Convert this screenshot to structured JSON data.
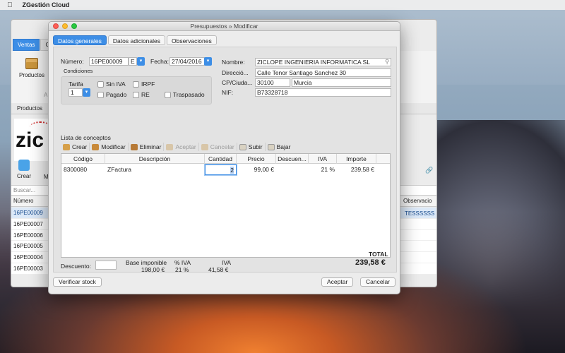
{
  "menubar": {
    "app_name": "ZGestión Cloud"
  },
  "bg_window": {
    "tabs": [
      "Ventas",
      "C"
    ],
    "ribbon_button": "Productos",
    "ribbon_group_letter": "A",
    "subtab": "Productos",
    "logo_text": "zic",
    "crear_label": "Crear",
    "m_label": "M",
    "search_placeholder": "Buscar...",
    "list_header": "Número",
    "obs_header": "Observacio",
    "obs_value": "TESSSSSS",
    "rows": [
      "16PE00009",
      "16PE00007",
      "16PE00006",
      "16PE00005",
      "16PE00004",
      "16PE00003"
    ]
  },
  "dialog": {
    "title": "Presupuestos » Modificar",
    "tabs": [
      "Datos generales",
      "Datos adicionales",
      "Observaciones"
    ],
    "numero_label": "Número:",
    "numero_value": "16PE00009",
    "serie_value": "E",
    "fecha_label": "Fecha:",
    "fecha_value": "27/04/2016",
    "condiciones_label": "Condiciones",
    "tarifa_label": "Tarifa",
    "tarifa_value": "1",
    "checks": [
      "Sin IVA",
      "IRPF",
      "Pagado",
      "RE",
      "Traspasado"
    ],
    "nombre_label": "Nombre:",
    "nombre_value": "ZICLOPE INGENIERIA INFORMATICA SL",
    "direccion_label": "Direcció...",
    "direccion_value": "Calle Tenor Santiago Sanchez 30",
    "cp_label": "CP/Ciuda...",
    "cp_value": "30100",
    "ciudad_value": "Murcia",
    "nif_label": "NIF:",
    "nif_value": "B73328718",
    "lista_label": "Lista de conceptos",
    "toolbar": [
      "Crear",
      "Modificar",
      "Eliminar",
      "Aceptar",
      "Cancelar",
      "Subir",
      "Bajar"
    ],
    "columns": [
      "Código",
      "Descripción",
      "Cantidad",
      "Precio",
      "Descuen...",
      "IVA",
      "Importe"
    ],
    "row": {
      "codigo": "8300080",
      "descripcion": "ZFactura",
      "cantidad": "2",
      "precio": "99,00 €",
      "descuento": "",
      "iva": "21 %",
      "importe": "239,58 €"
    },
    "descuento_label": "Descuento:",
    "base_label": "Base imponible",
    "base_value": "198,00 €",
    "pct_iva_label": "% IVA",
    "pct_iva_value": "21 %",
    "iva_label": "IVA",
    "iva_value": "41,58 €",
    "total_label": "TOTAL",
    "total_value": "239,58 €",
    "verificar_label": "Verificar stock",
    "aceptar_label": "Aceptar",
    "cancelar_label": "Cancelar"
  }
}
